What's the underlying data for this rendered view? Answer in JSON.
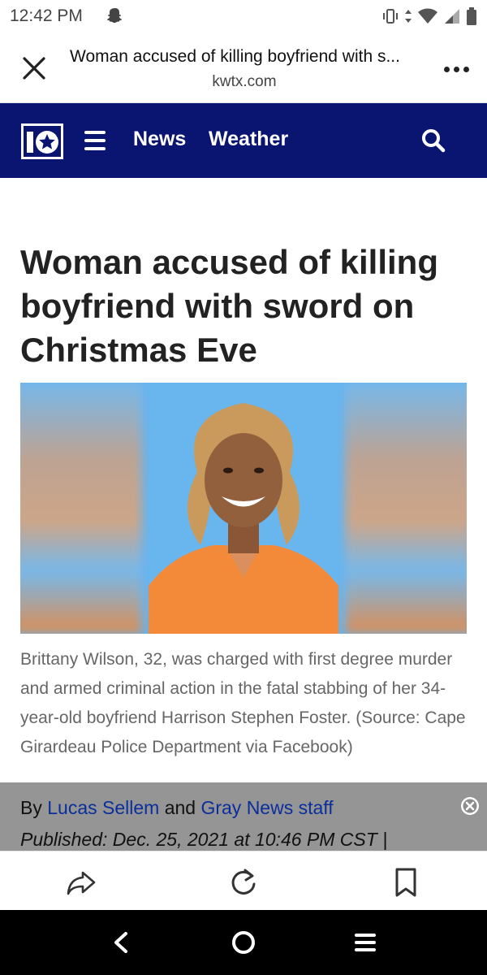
{
  "status_bar": {
    "time": "12:42 PM"
  },
  "tab": {
    "title": "Woman accused of killing boyfriend with s...",
    "domain": "kwtx.com"
  },
  "nav": {
    "logo_text": "10",
    "news": "News",
    "weather": "Weather"
  },
  "article": {
    "headline": "Woman accused of killing boyfriend with sword on Christmas Eve",
    "caption": "Brittany Wilson, 32, was charged with first degree murder and armed criminal action in the fatal stabbing of her 34-year-old boyfriend Harrison Stephen Foster.  (Source: Cape Girardeau Police Department via Facebook)",
    "byline_prefix": "By",
    "author_1": "Lucas Sellem",
    "byline_and": "and",
    "author_2": "Gray News staff",
    "published": "Published: Dec. 25, 2021 at 10:46 PM CST  |"
  },
  "icons": {
    "status": [
      "snapchat-icon",
      "vibrate-icon",
      "data-arrows-icon",
      "wifi-icon",
      "signal-icon",
      "battery-icon"
    ],
    "header": [
      "close-icon",
      "more-options-icon"
    ],
    "nav": [
      "station-logo",
      "menu-icon",
      "search-icon"
    ],
    "toolbar": [
      "share-icon",
      "refresh-icon",
      "bookmark-icon"
    ],
    "system": [
      "back-icon",
      "home-icon",
      "recents-icon"
    ]
  },
  "colors": {
    "nav_bg": "#0a1571",
    "link": "#0b2e9a",
    "byline_bg": "#8c8c8c"
  }
}
